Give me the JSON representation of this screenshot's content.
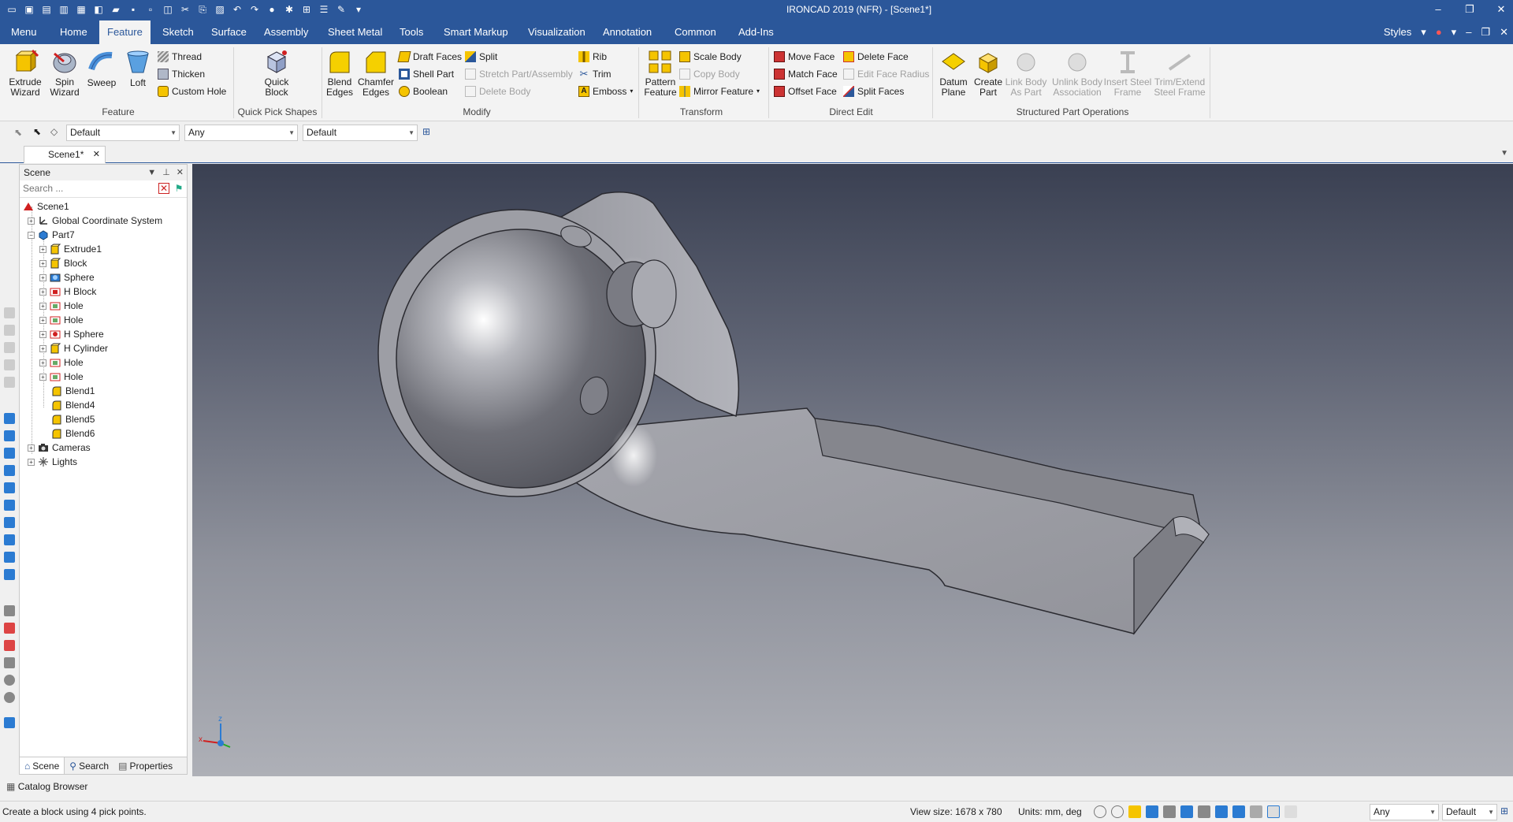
{
  "window": {
    "title": "IRONCAD 2019 (NFR) - [Scene1*]"
  },
  "tabs": {
    "items": [
      "Menu",
      "Home",
      "Feature",
      "Sketch",
      "Surface",
      "Assembly",
      "Sheet Metal",
      "Tools",
      "Smart Markup",
      "Visualization",
      "Annotation",
      "Common",
      "Add-Ins"
    ],
    "active": "Feature",
    "styles_label": "Styles"
  },
  "ribbon": {
    "feature": {
      "extrude": "Extrude Wizard",
      "spin": "Spin Wizard",
      "sweep": "Sweep",
      "loft": "Loft",
      "thread": "Thread",
      "thicken": "Thicken",
      "custom_hole": "Custom Hole",
      "group": "Feature"
    },
    "quick_pick": {
      "quick_block": "Quick Block",
      "group": "Quick Pick Shapes"
    },
    "modify": {
      "blend": "Blend Edges",
      "chamfer": "Chamfer Edges",
      "draft": "Draft Faces",
      "shell": "Shell Part",
      "boolean": "Boolean",
      "split": "Split",
      "stretch": "Stretch Part/Assembly",
      "delete_body": "Delete Body",
      "rib": "Rib",
      "trim": "Trim",
      "emboss": "Emboss",
      "group": "Modify"
    },
    "transform": {
      "pattern": "Pattern Feature",
      "scale": "Scale Body",
      "copy": "Copy Body",
      "mirror": "Mirror Feature",
      "group": "Transform"
    },
    "direct_edit": {
      "move_face": "Move Face",
      "match_face": "Match Face",
      "offset_face": "Offset Face",
      "delete_face": "Delete Face",
      "edit_face_radius": "Edit Face Radius",
      "split_faces": "Split Faces",
      "group": "Direct Edit"
    },
    "structured": {
      "datum_plane": "Datum Plane",
      "create_part": "Create Part",
      "link_body": "Link Body As Part",
      "unlink_body": "Unlink Body Association",
      "insert_steel": "Insert Steel Frame",
      "trim_extend": "Trim/Extend Steel Frame",
      "group": "Structured Part Operations"
    }
  },
  "toolbar2": {
    "combo1": "Default",
    "combo2": "Any",
    "combo3": "Default"
  },
  "document": {
    "tab_label": "Scene1*"
  },
  "scene_panel": {
    "title": "Scene",
    "search_placeholder": "Search ...",
    "tree": [
      {
        "label": "Scene1",
        "icon": "scene-icon"
      },
      {
        "label": "Global Coordinate System",
        "icon": "coordinate-system-icon"
      },
      {
        "label": "Part7",
        "icon": "part-icon"
      },
      {
        "label": "Extrude1",
        "icon": "extrude-icon"
      },
      {
        "label": "Block",
        "icon": "block-icon"
      },
      {
        "label": "Sphere",
        "icon": "sphere-icon"
      },
      {
        "label": "H Block",
        "icon": "block-icon"
      },
      {
        "label": "Hole",
        "icon": "hole-icon"
      },
      {
        "label": "Hole",
        "icon": "hole-icon"
      },
      {
        "label": "H Sphere",
        "icon": "sphere-icon"
      },
      {
        "label": "H Cylinder",
        "icon": "cylinder-icon"
      },
      {
        "label": "Hole",
        "icon": "hole-icon"
      },
      {
        "label": "Hole",
        "icon": "hole-icon"
      },
      {
        "label": "Blend1",
        "icon": "blend-icon"
      },
      {
        "label": "Blend4",
        "icon": "blend-icon"
      },
      {
        "label": "Blend5",
        "icon": "blend-icon"
      },
      {
        "label": "Blend6",
        "icon": "blend-icon"
      },
      {
        "label": "Cameras",
        "icon": "camera-icon"
      },
      {
        "label": "Lights",
        "icon": "light-icon"
      }
    ],
    "bottom_tabs": [
      "Scene",
      "Search",
      "Properties"
    ]
  },
  "catalog": {
    "label": "Catalog Browser"
  },
  "status": {
    "message": "Create a block using 4 pick points.",
    "view_size": "View size: 1678 x 780",
    "units": "Units: mm, deg",
    "combo1": "Any",
    "combo2": "Default"
  },
  "colors": {
    "brand": "#2b579a",
    "viewport_top": "#3a4052",
    "viewport_bottom": "#aeb0b7"
  }
}
